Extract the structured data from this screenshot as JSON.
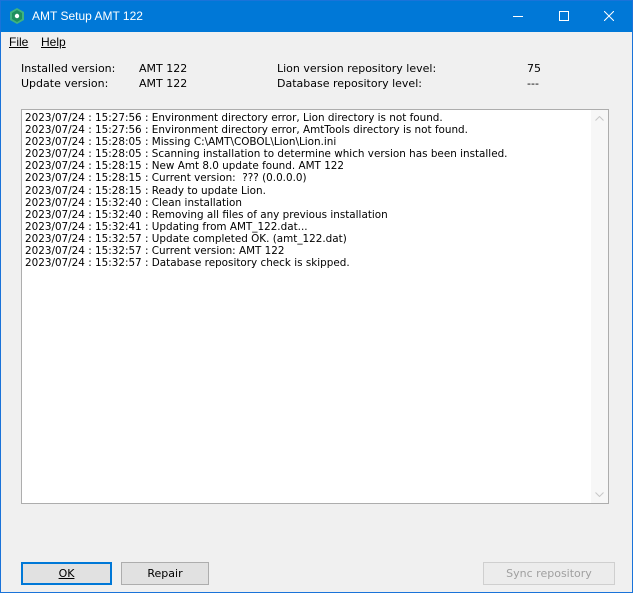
{
  "window": {
    "title": "AMT Setup AMT 122",
    "accent_color": "#0078d7"
  },
  "menu": {
    "file_label": "File",
    "help_label": "Help"
  },
  "info": {
    "installed_version_label": "Installed version:",
    "installed_version_value": "AMT 122",
    "update_version_label": "Update version:",
    "update_version_value": "AMT 122",
    "lion_repo_label": "Lion version repository level:",
    "lion_repo_value": "75",
    "db_repo_label": "Database repository level:",
    "db_repo_value": "---"
  },
  "log": {
    "lines": [
      "2023/07/24 : 15:27:56 : Environment directory error, Lion directory is not found.",
      "2023/07/24 : 15:27:56 : Environment directory error, AmtTools directory is not found.",
      "2023/07/24 : 15:28:05 : Missing C:\\AMT\\COBOL\\Lion\\Lion.ini",
      "2023/07/24 : 15:28:05 : Scanning installation to determine which version has been installed.",
      "2023/07/24 : 15:28:15 : New Amt 8.0 update found. AMT 122",
      "2023/07/24 : 15:28:15 : Current version:  ??? (0.0.0.0)",
      "2023/07/24 : 15:28:15 : Ready to update Lion.",
      "2023/07/24 : 15:32:40 : Clean installation",
      "2023/07/24 : 15:32:40 : Removing all files of any previous installation",
      "2023/07/24 : 15:32:41 : Updating from AMT_122.dat...",
      "2023/07/24 : 15:32:57 : Update completed OK. (amt_122.dat)",
      "2023/07/24 : 15:32:57 : Current version: AMT 122",
      "2023/07/24 : 15:32:57 : Database repository check is skipped."
    ]
  },
  "buttons": {
    "ok_label": "OK",
    "repair_label": "Repair",
    "sync_label": "Sync repository"
  },
  "icons": {
    "app": "app-logo-icon",
    "minimize": "minimize-icon",
    "maximize": "maximize-icon",
    "close": "close-icon"
  }
}
